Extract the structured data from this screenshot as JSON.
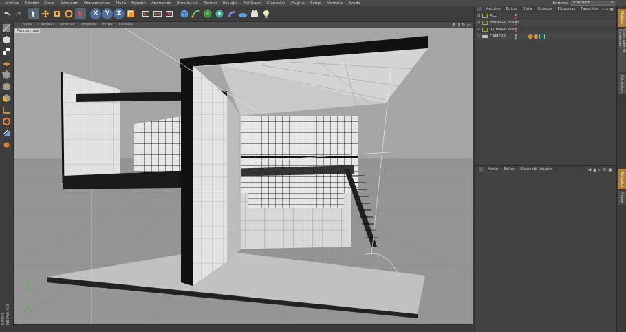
{
  "menu": [
    "Archivo",
    "Edición",
    "Crear",
    "Selección",
    "Herramientas",
    "Malla",
    "Fijación",
    "Animación",
    "Simulación",
    "Render",
    "Esculpir",
    "MoGraph",
    "Character",
    "Plugins",
    "Script",
    "Ventana",
    "Ayuda"
  ],
  "layout": {
    "label": "Entorno:",
    "value": "Standard"
  },
  "toolbar": {
    "icons": [
      "undo-icon",
      "redo-icon",
      "live-selection-icon",
      "move-icon",
      "scale-icon",
      "rotate-icon",
      "recent-tool-icon",
      "x-axis-icon",
      "y-axis-icon",
      "z-axis-icon",
      "world-coordinates-icon",
      "render-view-icon",
      "render-picture-viewer-icon",
      "edit-render-settings-icon",
      "cube-icon",
      "pen-spline-icon",
      "subdivision-surface-icon",
      "array-icon",
      "bend-deformer-icon",
      "floor-icon",
      "camera-icon",
      "light-icon"
    ],
    "axes": [
      "X",
      "Y",
      "Z"
    ]
  },
  "left_tools": [
    "make-editable-icon",
    "model-mode-icon",
    "texture-mode-icon",
    "workplane-icon",
    "points-mode-icon",
    "edges-mode-icon",
    "polygons-mode-icon",
    "axis-mode-icon",
    "tweak-icon",
    "snap-icon",
    "locked-workplane-icon"
  ],
  "logo": {
    "line1": "MAXON",
    "line2": "CINEMA 4D"
  },
  "viewport": {
    "menu": [
      "Vista",
      "Cámaras",
      "Mostrar",
      "Opciones",
      "Filtrar",
      "Paneles"
    ],
    "label": "Perspectiva",
    "nav_icons": [
      "move-view-icon",
      "zoom-view-icon",
      "rotate-view-icon",
      "maximize-view-icon"
    ]
  },
  "object_manager": {
    "menu": [
      "Archivo",
      "Editar",
      "Vista",
      "Objetos",
      "Etiquetas",
      "Favoritos"
    ],
    "objects": [
      {
        "name": "ALL",
        "color": "#8ab04f"
      },
      {
        "name": "BACKGROUNDS",
        "color": "#8ab04f"
      },
      {
        "name": "ILUMINATION",
        "color": "#8ab04f"
      },
      {
        "name": "CAMERA",
        "color": "#c0c0c0"
      }
    ]
  },
  "attribute_manager": {
    "menu": [
      "Modo",
      "Editar",
      "Datos de Usuario"
    ]
  },
  "side_tabs": [
    "Objetos",
    "Explorador de Contenido",
    "Estructura",
    "Atributos",
    "Capas"
  ],
  "colors": {
    "accent": "#b07d3a",
    "viewport_bg": "#9f9f9f"
  }
}
